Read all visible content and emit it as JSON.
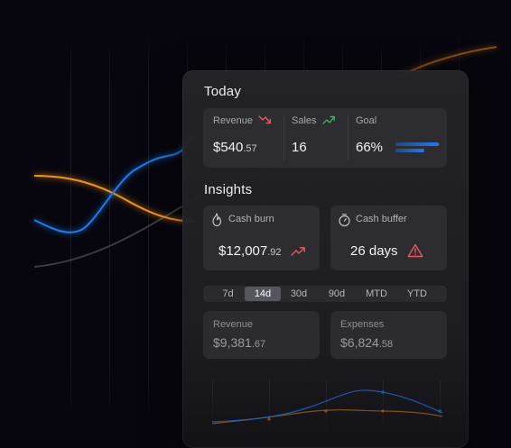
{
  "today": {
    "title": "Today",
    "revenue": {
      "label": "Revenue",
      "value": "$540",
      "cents": ".57",
      "trend": "down",
      "trend_color": "#e35a5a"
    },
    "sales": {
      "label": "Sales",
      "value": "16",
      "trend": "up",
      "trend_color": "#3fae5c"
    },
    "goal": {
      "label": "Goal",
      "value": "66%",
      "progress": 0.66,
      "bar_color": "#1f7bf0"
    }
  },
  "insights": {
    "title": "Insights",
    "cash_burn": {
      "label": "Cash burn",
      "icon": "flame-icon",
      "value": "$12,007",
      "cents": ".92",
      "trend": "up",
      "trend_color": "#e35a5a"
    },
    "cash_buffer": {
      "label": "Cash buffer",
      "icon": "stopwatch-icon",
      "value": "26 days",
      "alert": "warning-triangle-icon",
      "alert_color": "#e35a5a"
    }
  },
  "ranges": {
    "options": [
      "7d",
      "14d",
      "30d",
      "90d",
      "MTD",
      "YTD"
    ],
    "selected": "14d"
  },
  "summary": {
    "revenue": {
      "label": "Revenue",
      "value": "$9,381",
      "cents": ".67"
    },
    "expenses": {
      "label": "Expenses",
      "value": "$6,824",
      "cents": ".58"
    }
  },
  "colors": {
    "accent_blue": "#1f7bf0",
    "accent_orange": "#f0941f",
    "negative": "#e35a5a",
    "positive": "#3fae5c",
    "card_bg": "#242428"
  }
}
